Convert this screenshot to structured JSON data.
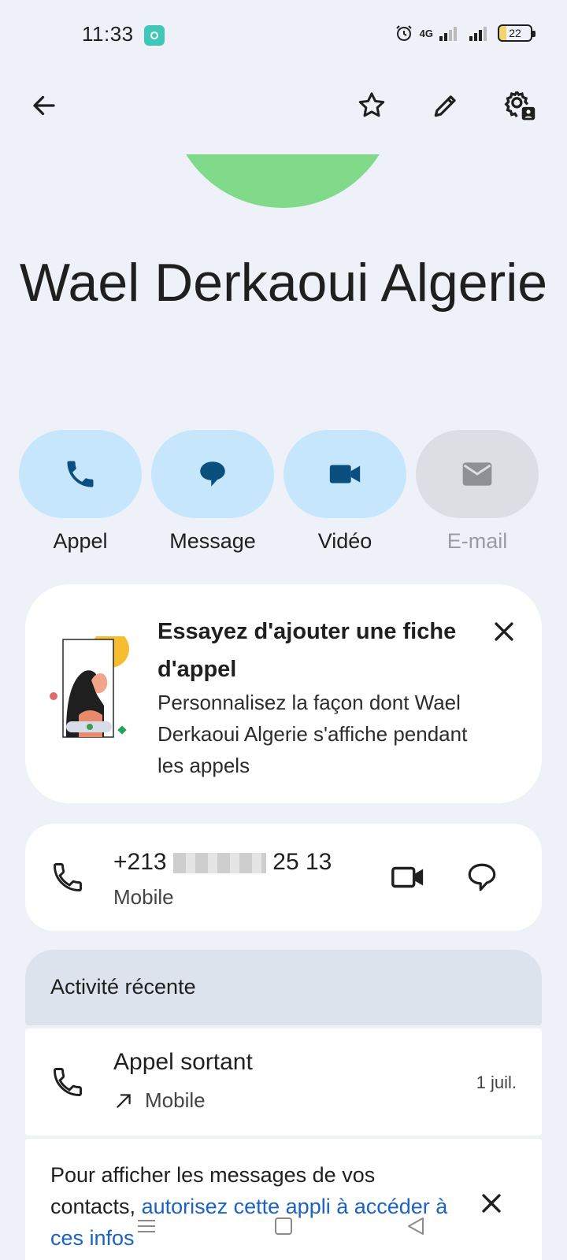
{
  "status_bar": {
    "time": "11:33",
    "network": "4G",
    "battery": "22"
  },
  "app_bar": {
    "back_icon": "arrow-left-icon",
    "favorite_icon": "star-outline-icon",
    "edit_icon": "pencil-icon",
    "settings_icon": "contact-settings-icon"
  },
  "contact": {
    "name": "Wael Derkaoui Algerie",
    "avatar_color": "#81d98a"
  },
  "actions": [
    {
      "label": "Appel",
      "icon": "phone-icon",
      "enabled": true
    },
    {
      "label": "Message",
      "icon": "message-icon",
      "enabled": true
    },
    {
      "label": "Vidéo",
      "icon": "video-icon",
      "enabled": true
    },
    {
      "label": "E-mail",
      "icon": "mail-icon",
      "enabled": false
    }
  ],
  "promo": {
    "title": "Essayez d'ajouter une fiche d'appel",
    "body": "Personnalisez la façon dont Wael Derkaoui Algerie s'affiche pendant les appels"
  },
  "phone": {
    "number_prefix": "+213",
    "number_suffix": "25 13",
    "type": "Mobile"
  },
  "recent": {
    "header": "Activité récente",
    "items": [
      {
        "title": "Appel sortant",
        "subtitle": "Mobile",
        "date": "1 juil."
      }
    ]
  },
  "notice": {
    "text": "Pour afficher les messages de vos contacts,",
    "link": " autorisez cette appli à accéder à ces infos"
  },
  "colors": {
    "background": "#eef1f8",
    "action_pill": "#c6e6fb",
    "action_icon": "#0b4f7e",
    "link": "#1a63c4"
  }
}
